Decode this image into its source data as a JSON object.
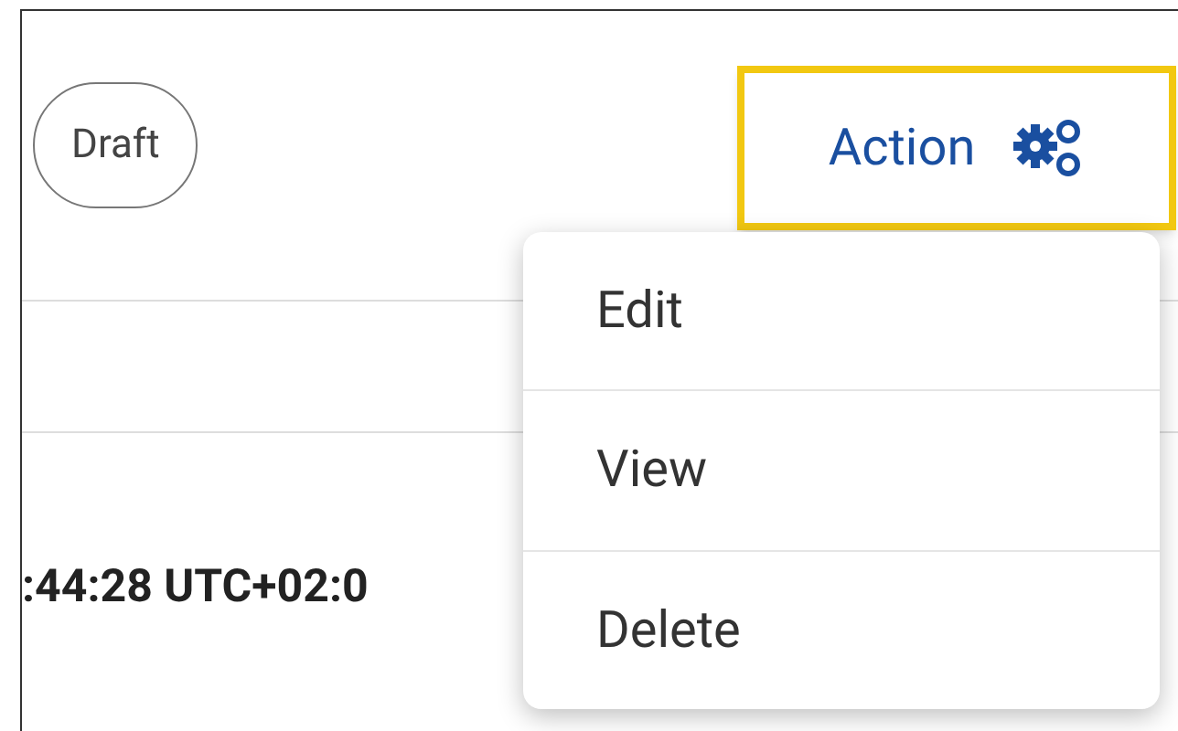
{
  "status_badge": "Draft",
  "action_button": {
    "label": "Action",
    "focused": true
  },
  "menu": {
    "items": [
      {
        "label": "Edit"
      },
      {
        "label": "View"
      },
      {
        "label": "Delete"
      }
    ]
  },
  "row": {
    "timestamp": ":44:28 UTC+02:0"
  }
}
